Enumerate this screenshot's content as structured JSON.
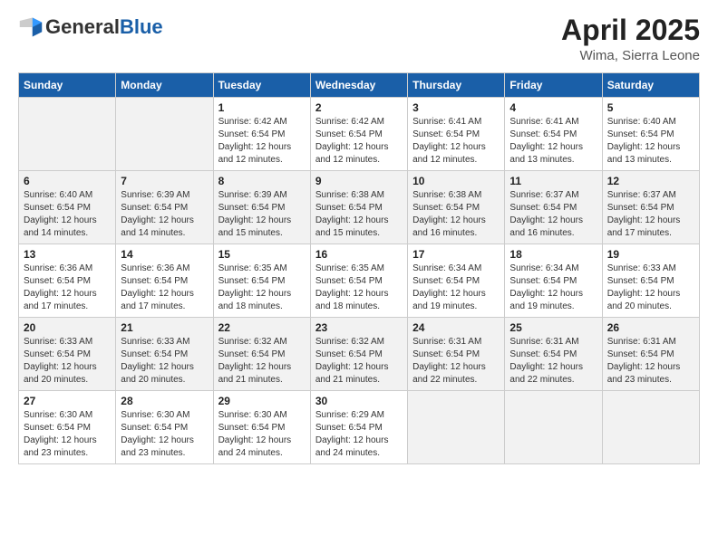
{
  "header": {
    "logo_general": "General",
    "logo_blue": "Blue",
    "title": "April 2025",
    "subtitle": "Wima, Sierra Leone"
  },
  "weekdays": [
    "Sunday",
    "Monday",
    "Tuesday",
    "Wednesday",
    "Thursday",
    "Friday",
    "Saturday"
  ],
  "weeks": [
    [
      {
        "day": "",
        "sunrise": "",
        "sunset": "",
        "daylight": ""
      },
      {
        "day": "",
        "sunrise": "",
        "sunset": "",
        "daylight": ""
      },
      {
        "day": "1",
        "sunrise": "Sunrise: 6:42 AM",
        "sunset": "Sunset: 6:54 PM",
        "daylight": "Daylight: 12 hours and 12 minutes."
      },
      {
        "day": "2",
        "sunrise": "Sunrise: 6:42 AM",
        "sunset": "Sunset: 6:54 PM",
        "daylight": "Daylight: 12 hours and 12 minutes."
      },
      {
        "day": "3",
        "sunrise": "Sunrise: 6:41 AM",
        "sunset": "Sunset: 6:54 PM",
        "daylight": "Daylight: 12 hours and 12 minutes."
      },
      {
        "day": "4",
        "sunrise": "Sunrise: 6:41 AM",
        "sunset": "Sunset: 6:54 PM",
        "daylight": "Daylight: 12 hours and 13 minutes."
      },
      {
        "day": "5",
        "sunrise": "Sunrise: 6:40 AM",
        "sunset": "Sunset: 6:54 PM",
        "daylight": "Daylight: 12 hours and 13 minutes."
      }
    ],
    [
      {
        "day": "6",
        "sunrise": "Sunrise: 6:40 AM",
        "sunset": "Sunset: 6:54 PM",
        "daylight": "Daylight: 12 hours and 14 minutes."
      },
      {
        "day": "7",
        "sunrise": "Sunrise: 6:39 AM",
        "sunset": "Sunset: 6:54 PM",
        "daylight": "Daylight: 12 hours and 14 minutes."
      },
      {
        "day": "8",
        "sunrise": "Sunrise: 6:39 AM",
        "sunset": "Sunset: 6:54 PM",
        "daylight": "Daylight: 12 hours and 15 minutes."
      },
      {
        "day": "9",
        "sunrise": "Sunrise: 6:38 AM",
        "sunset": "Sunset: 6:54 PM",
        "daylight": "Daylight: 12 hours and 15 minutes."
      },
      {
        "day": "10",
        "sunrise": "Sunrise: 6:38 AM",
        "sunset": "Sunset: 6:54 PM",
        "daylight": "Daylight: 12 hours and 16 minutes."
      },
      {
        "day": "11",
        "sunrise": "Sunrise: 6:37 AM",
        "sunset": "Sunset: 6:54 PM",
        "daylight": "Daylight: 12 hours and 16 minutes."
      },
      {
        "day": "12",
        "sunrise": "Sunrise: 6:37 AM",
        "sunset": "Sunset: 6:54 PM",
        "daylight": "Daylight: 12 hours and 17 minutes."
      }
    ],
    [
      {
        "day": "13",
        "sunrise": "Sunrise: 6:36 AM",
        "sunset": "Sunset: 6:54 PM",
        "daylight": "Daylight: 12 hours and 17 minutes."
      },
      {
        "day": "14",
        "sunrise": "Sunrise: 6:36 AM",
        "sunset": "Sunset: 6:54 PM",
        "daylight": "Daylight: 12 hours and 17 minutes."
      },
      {
        "day": "15",
        "sunrise": "Sunrise: 6:35 AM",
        "sunset": "Sunset: 6:54 PM",
        "daylight": "Daylight: 12 hours and 18 minutes."
      },
      {
        "day": "16",
        "sunrise": "Sunrise: 6:35 AM",
        "sunset": "Sunset: 6:54 PM",
        "daylight": "Daylight: 12 hours and 18 minutes."
      },
      {
        "day": "17",
        "sunrise": "Sunrise: 6:34 AM",
        "sunset": "Sunset: 6:54 PM",
        "daylight": "Daylight: 12 hours and 19 minutes."
      },
      {
        "day": "18",
        "sunrise": "Sunrise: 6:34 AM",
        "sunset": "Sunset: 6:54 PM",
        "daylight": "Daylight: 12 hours and 19 minutes."
      },
      {
        "day": "19",
        "sunrise": "Sunrise: 6:33 AM",
        "sunset": "Sunset: 6:54 PM",
        "daylight": "Daylight: 12 hours and 20 minutes."
      }
    ],
    [
      {
        "day": "20",
        "sunrise": "Sunrise: 6:33 AM",
        "sunset": "Sunset: 6:54 PM",
        "daylight": "Daylight: 12 hours and 20 minutes."
      },
      {
        "day": "21",
        "sunrise": "Sunrise: 6:33 AM",
        "sunset": "Sunset: 6:54 PM",
        "daylight": "Daylight: 12 hours and 20 minutes."
      },
      {
        "day": "22",
        "sunrise": "Sunrise: 6:32 AM",
        "sunset": "Sunset: 6:54 PM",
        "daylight": "Daylight: 12 hours and 21 minutes."
      },
      {
        "day": "23",
        "sunrise": "Sunrise: 6:32 AM",
        "sunset": "Sunset: 6:54 PM",
        "daylight": "Daylight: 12 hours and 21 minutes."
      },
      {
        "day": "24",
        "sunrise": "Sunrise: 6:31 AM",
        "sunset": "Sunset: 6:54 PM",
        "daylight": "Daylight: 12 hours and 22 minutes."
      },
      {
        "day": "25",
        "sunrise": "Sunrise: 6:31 AM",
        "sunset": "Sunset: 6:54 PM",
        "daylight": "Daylight: 12 hours and 22 minutes."
      },
      {
        "day": "26",
        "sunrise": "Sunrise: 6:31 AM",
        "sunset": "Sunset: 6:54 PM",
        "daylight": "Daylight: 12 hours and 23 minutes."
      }
    ],
    [
      {
        "day": "27",
        "sunrise": "Sunrise: 6:30 AM",
        "sunset": "Sunset: 6:54 PM",
        "daylight": "Daylight: 12 hours and 23 minutes."
      },
      {
        "day": "28",
        "sunrise": "Sunrise: 6:30 AM",
        "sunset": "Sunset: 6:54 PM",
        "daylight": "Daylight: 12 hours and 23 minutes."
      },
      {
        "day": "29",
        "sunrise": "Sunrise: 6:30 AM",
        "sunset": "Sunset: 6:54 PM",
        "daylight": "Daylight: 12 hours and 24 minutes."
      },
      {
        "day": "30",
        "sunrise": "Sunrise: 6:29 AM",
        "sunset": "Sunset: 6:54 PM",
        "daylight": "Daylight: 12 hours and 24 minutes."
      },
      {
        "day": "",
        "sunrise": "",
        "sunset": "",
        "daylight": ""
      },
      {
        "day": "",
        "sunrise": "",
        "sunset": "",
        "daylight": ""
      },
      {
        "day": "",
        "sunrise": "",
        "sunset": "",
        "daylight": ""
      }
    ]
  ]
}
